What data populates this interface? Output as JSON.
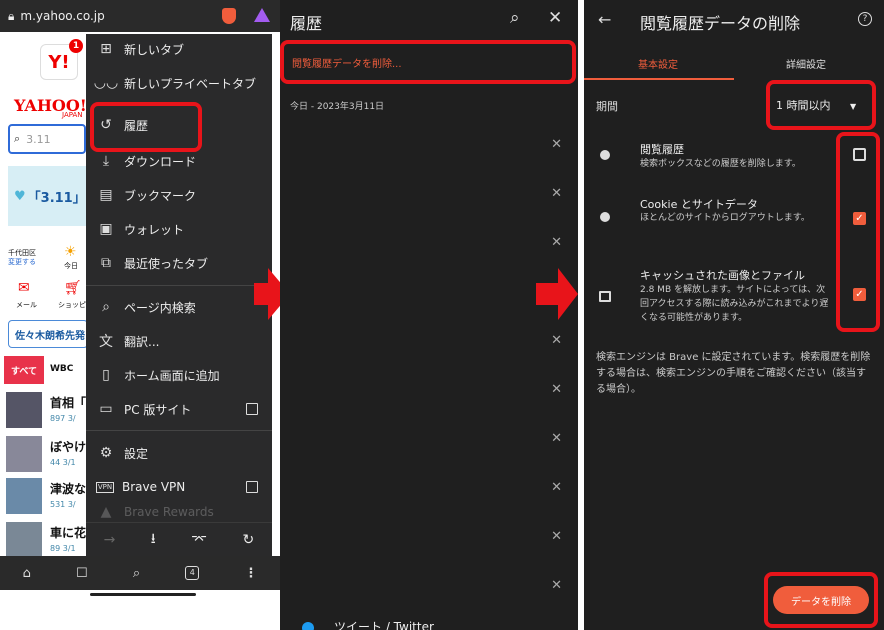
{
  "browser": {
    "url": "m.yahoo.co.jp",
    "tabs_count": "4"
  },
  "yahoo": {
    "logo_badge": "1",
    "logo": "Y!",
    "wordmark": "YAHOO!",
    "wordmark_sub": "JAPAN",
    "search_value": "3.11",
    "banner": "「3.11」",
    "weather_loc": "千代田区",
    "weather_change": "変更する",
    "weather_today": "今日",
    "mail": "メール",
    "shopping": "ショッピ",
    "promo": "佐々木朗希先発",
    "tabs": [
      "すべて",
      "WBC"
    ],
    "news": [
      {
        "t": "首相「",
        "m": "897  3/"
      },
      {
        "t": "ぼやけ",
        "m": "44  3/1"
      },
      {
        "t": "津波な",
        "m": "531  3/"
      },
      {
        "t": "車に花",
        "m": "89  3/1"
      }
    ]
  },
  "menu": {
    "items": [
      "新しいタブ",
      "新しいプライベートタブ",
      "履歴",
      "ダウンロード",
      "ブックマーク",
      "ウォレット",
      "最近使ったタブ",
      "ページ内検索",
      "翻訳...",
      "ホーム画面に追加",
      "PC 版サイト",
      "設定",
      "Brave VPN",
      "Brave Rewards"
    ]
  },
  "history": {
    "title": "履歴",
    "clear_link": "閲覧履歴データを削除...",
    "date_header": "今日 - 2023年3月11日",
    "last_item": "ツイート / Twitter"
  },
  "clear": {
    "title": "閲覧履歴データの削除",
    "tab_basic": "基本設定",
    "tab_advanced": "詳細設定",
    "period_label": "期間",
    "period_value": "1 時間以内",
    "items": [
      {
        "title": "閲覧履歴",
        "desc": "検索ボックスなどの履歴を削除します。",
        "checked": false
      },
      {
        "title": "Cookie とサイトデータ",
        "desc": "ほとんどのサイトからログアウトします。",
        "checked": true
      },
      {
        "title": "キャッシュされた画像とファイル",
        "desc": "2.8 MB を解放します。サイトによっては、次回アクセスする際に読み込みがこれまでより遅くなる可能性があります。",
        "checked": true
      }
    ],
    "note": "検索エンジンは Brave に設定されています。検索履歴を削除する場合は、検索エンジンの手順をご確認ください（該当する場合）。",
    "button": "データを削除"
  },
  "colors": {
    "accent": "#f05d3c",
    "highlight": "#e8141a",
    "panel_bg": "#1f1f1f"
  }
}
